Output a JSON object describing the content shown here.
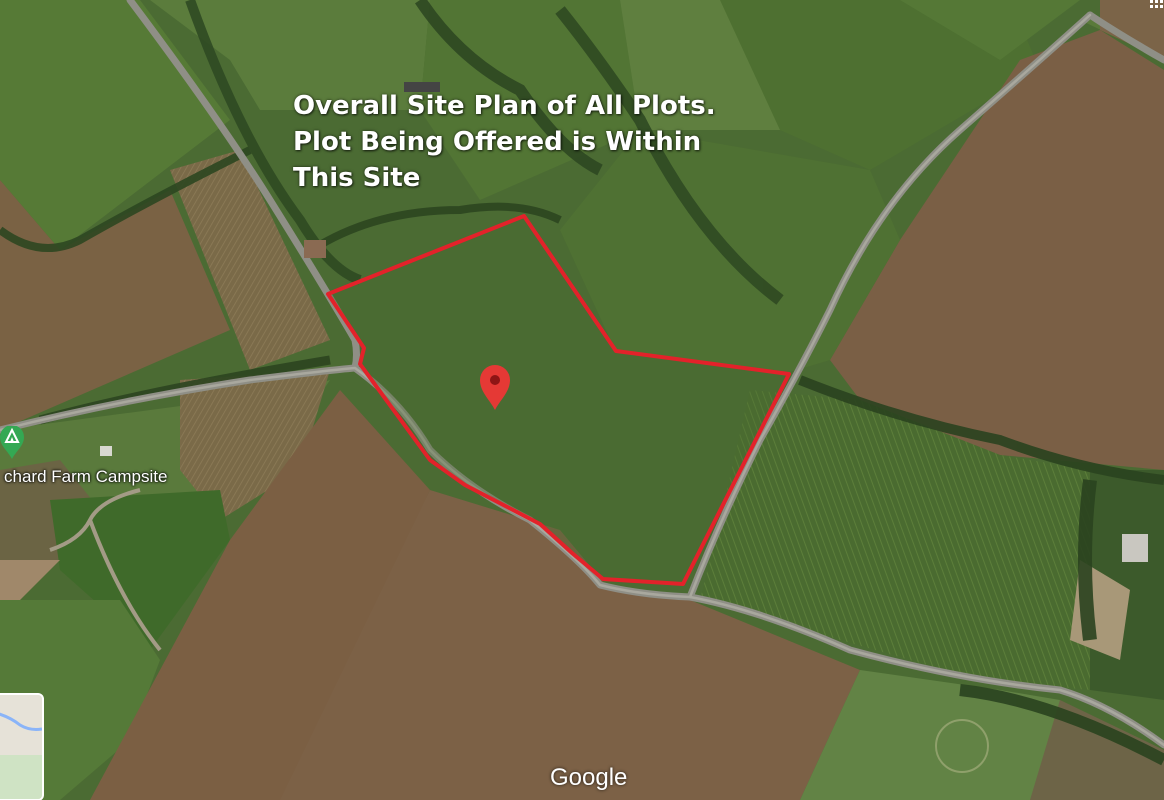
{
  "annotation": {
    "lines": [
      "Overall Site Plan of All Plots.",
      "Plot Being Offered is Within",
      "This Site"
    ]
  },
  "poi": {
    "label": "chard Farm Campsite",
    "icon": "campsite-icon",
    "color": "#34a853"
  },
  "map": {
    "provider_logo": "Google",
    "boundary_color": "#e3222a",
    "marker_color": "#e53935",
    "marker_icon": "location-pin-icon",
    "imagery": "satellite"
  }
}
